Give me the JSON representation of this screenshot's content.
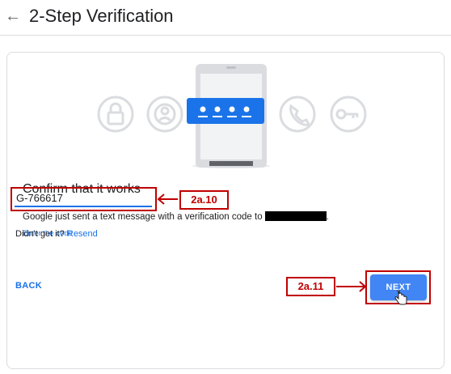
{
  "header": {
    "back_glyph": "←",
    "title": "2-Step Verification"
  },
  "card": {
    "heading": "Confirm that it works",
    "message": "Google just sent a text message with a verification code to",
    "message_end": ".",
    "code_label": "Enter the code",
    "code_value": "G-766617",
    "didnt_get": "Didn't get it?",
    "resend": "Resend",
    "back": "BACK",
    "next": "NEXT",
    "code_dots": "• • • •"
  },
  "annotations": {
    "input_tag": "2a.10",
    "next_tag": "2a.11"
  },
  "colors": {
    "accent": "#1a73e8",
    "next_bg": "#4285f4",
    "annotation": "#c00000"
  },
  "icons": [
    "lock-icon",
    "account-icon",
    "phone-device-icon",
    "call-icon",
    "key-icon"
  ]
}
